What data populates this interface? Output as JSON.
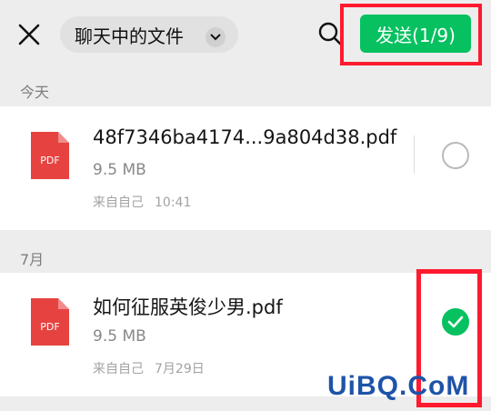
{
  "header": {
    "filter_label": "聊天中的文件",
    "send_label": "发送(1/9)"
  },
  "icons": {
    "close": "close-icon",
    "dropdown": "chevron-down-icon",
    "search": "search-icon",
    "file": "pdf-file-icon",
    "check": "check-icon"
  },
  "colors": {
    "accent": "#07c160",
    "pdf_red": "#e64340",
    "annotation": "#ff1a2e"
  },
  "sections": [
    {
      "label": "今天",
      "files": [
        {
          "icon_text": "PDF",
          "name": "48f7346ba4174...9a804d38.pdf",
          "size": "9.5 MB",
          "source": "来自自己",
          "time": "10:41",
          "selected": false
        }
      ]
    },
    {
      "label": "7月",
      "files": [
        {
          "icon_text": "PDF",
          "name": "如何征服英俊少男.pdf",
          "size": "9.5 MB",
          "source": "来自自己",
          "time": "7月29日",
          "selected": true
        }
      ]
    }
  ],
  "watermark": "UiBQ.CoM"
}
